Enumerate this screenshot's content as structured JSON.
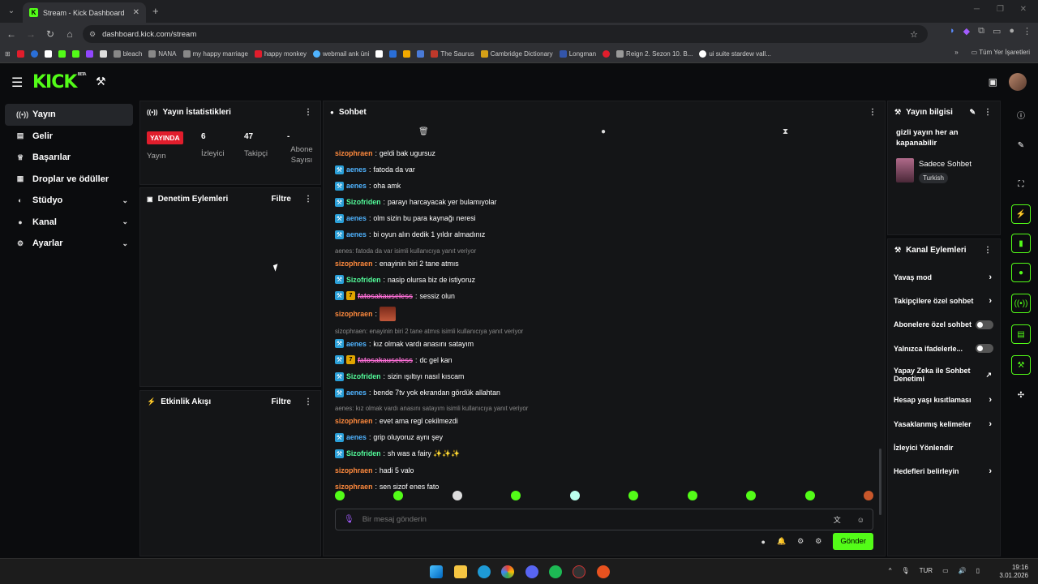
{
  "browser": {
    "tab_title": "Stream - Kick Dashboard",
    "url": "dashboard.kick.com/stream",
    "bookmarks": [
      "bleach",
      "NANA",
      "my happy marriage",
      "happy monkey",
      "webmail ank üni",
      "The Saurus",
      "Cambridge Dictionary",
      "Longman",
      "Reign 2. Sezon 10. B...",
      "ui suite stardew vall..."
    ],
    "all_bookmarks": "Tüm Yer İşaretleri"
  },
  "sidebar": {
    "items": [
      {
        "label": "Yayın",
        "icon": "broadcast-icon"
      },
      {
        "label": "Gelir",
        "icon": "wallet-icon"
      },
      {
        "label": "Başarılar",
        "icon": "trophy-icon"
      },
      {
        "label": "Droplar ve ödüller",
        "icon": "gift-icon"
      },
      {
        "label": "Stüdyo",
        "icon": "palette-icon"
      },
      {
        "label": "Kanal",
        "icon": "user-icon"
      },
      {
        "label": "Ayarlar",
        "icon": "gear-icon"
      }
    ]
  },
  "stats": {
    "title": "Yayın İstatistikleri",
    "live_badge": "YAYINDA",
    "live_label": "Yayın",
    "viewers_value": "6",
    "viewers_label": "İzleyici",
    "followers_value": "47",
    "followers_label": "Takipçi",
    "subs_value": "-",
    "subs_label": "Abone Sayısı"
  },
  "moderation": {
    "title": "Denetim Eylemleri",
    "filter": "Filtre"
  },
  "activity": {
    "title": "Etkinlik Akışı",
    "filter": "Filtre"
  },
  "chat": {
    "title": "Sohbet",
    "input_placeholder": "Bir mesaj gönderin",
    "send_label": "Gönder",
    "messages": [
      {
        "user": "sizophraen",
        "color": "orange",
        "text": "geldi bak ugursuz",
        "badge": ""
      },
      {
        "user": "aenes",
        "color": "blue",
        "text": "fatoda da var",
        "badge": "mod"
      },
      {
        "user": "aenes",
        "color": "blue",
        "text": "oha amk",
        "badge": "mod"
      },
      {
        "user": "Sizofriden",
        "color": "green",
        "text": "parayı harcayacak yer bulamıyolar",
        "badge": "mod"
      },
      {
        "user": "aenes",
        "color": "blue",
        "text": "olm sizin bu para kaynağı neresi",
        "badge": "mod"
      },
      {
        "user": "aenes",
        "color": "blue",
        "text": "bi oyun alın dedik 1 yıldır almadınız",
        "badge": "mod"
      },
      {
        "reply": "aenes: fatoda da var isimli kullanıcıya yanıt veriyor",
        "user": "sizophraen",
        "color": "orange",
        "text": "enayinin biri 2 tane atmıs",
        "badge": ""
      },
      {
        "user": "Sizofriden",
        "color": "green",
        "text": "nasip olursa biz de istiyoruz",
        "badge": "mod"
      },
      {
        "user": "fatosakauseless",
        "color": "pink",
        "text": "sessiz olun",
        "badge": "mod7"
      },
      {
        "user": "sizophraen",
        "color": "orange",
        "text": "",
        "badge": "",
        "emote": true
      },
      {
        "reply": "sizophraen: enayinin biri 2 tane atmıs isimli kullanıcıya yanıt veriyor",
        "user": "aenes",
        "color": "blue",
        "text": "kız olmak vardı anasını satayım",
        "badge": "mod"
      },
      {
        "user": "fatosakauseless",
        "color": "pink",
        "text": "dc gel kan",
        "badge": "mod7"
      },
      {
        "user": "Sizofriden",
        "color": "green",
        "text": "sizin ışıltıyı nasıl kıscam",
        "badge": "mod"
      },
      {
        "user": "aenes",
        "color": "blue",
        "text": "bende 7tv yok ekrandan gördük allahtan",
        "badge": "mod"
      },
      {
        "reply": "aenes: kız olmak vardı anasını satayım isimli kullanıcıya yanıt veriyor",
        "user": "sizophraen",
        "color": "orange",
        "text": "evet ama regl cekilmezdi",
        "badge": ""
      },
      {
        "user": "aenes",
        "color": "blue",
        "text": "grip oluyoruz aynı şey",
        "badge": "mod"
      },
      {
        "user": "Sizofriden",
        "color": "green",
        "text": "sh was a fairy ✨✨✨",
        "badge": "mod"
      },
      {
        "user": "sizophraen",
        "color": "orange",
        "text": "hadi 5 valo",
        "badge": ""
      },
      {
        "user": "sizophraen",
        "color": "orange",
        "text": "sen sizof enes fato",
        "badge": ""
      }
    ]
  },
  "stream_info": {
    "title": "Yayın bilgisi",
    "stream_title": "gizli yayın her an kapanabilir",
    "category": "Sadece Sohbet",
    "language": "Turkish"
  },
  "channel_actions": {
    "title": "Kanal Eylemleri",
    "items": [
      {
        "label": "Yavaş mod",
        "kind": "arrow"
      },
      {
        "label": "Takipçilere özel sohbet",
        "kind": "arrow"
      },
      {
        "label": "Abonelere özel sohbet",
        "kind": "toggle"
      },
      {
        "label": "Yalnızca ifadelerle...",
        "kind": "toggle"
      },
      {
        "label": "Yapay Zeka ile Sohbet Denetimi",
        "kind": "external"
      },
      {
        "label": "Hesap yaşı kısıtlaması",
        "kind": "arrow"
      },
      {
        "label": "Yasaklanmış kelimeler",
        "kind": "arrow"
      },
      {
        "label": "İzleyici Yönlendir",
        "kind": "none"
      },
      {
        "label": "Hedefleri belirleyin",
        "kind": "arrow"
      }
    ]
  },
  "taskbar": {
    "lang": "TUR",
    "time": "19:16",
    "date": "3.01.2026"
  },
  "colors": {
    "brand": "#53fc18",
    "live": "#e11d2c",
    "mod_badge": "#2a9fd8"
  }
}
